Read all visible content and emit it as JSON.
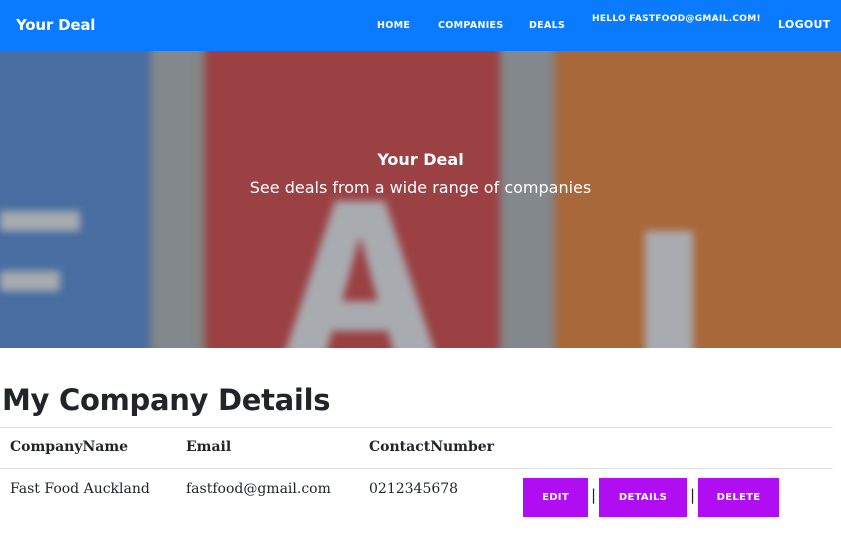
{
  "nav": {
    "brand": "Your Deal",
    "links": [
      "HOME",
      "COMPANIES",
      "DEALS"
    ],
    "greeting": "HELLO FASTFOOD@GMAIL.COM!",
    "logout": "LOGOUT"
  },
  "hero": {
    "title": "Your Deal",
    "subtitle": "See deals from a wide range of companies"
  },
  "main": {
    "heading": "My Company Details",
    "table": {
      "headers": [
        "CompanyName",
        "Email",
        "ContactNumber"
      ],
      "rows": [
        {
          "company_name": "Fast Food Auckland",
          "email": "fastfood@gmail.com",
          "contact_number": "0212345678",
          "actions": [
            "EDIT",
            "DETAILS",
            "DELETE"
          ],
          "separators": [
            "|",
            "|"
          ]
        }
      ]
    }
  },
  "colors": {
    "navbar": "#0a7bff",
    "action_button": "#b10df3"
  }
}
